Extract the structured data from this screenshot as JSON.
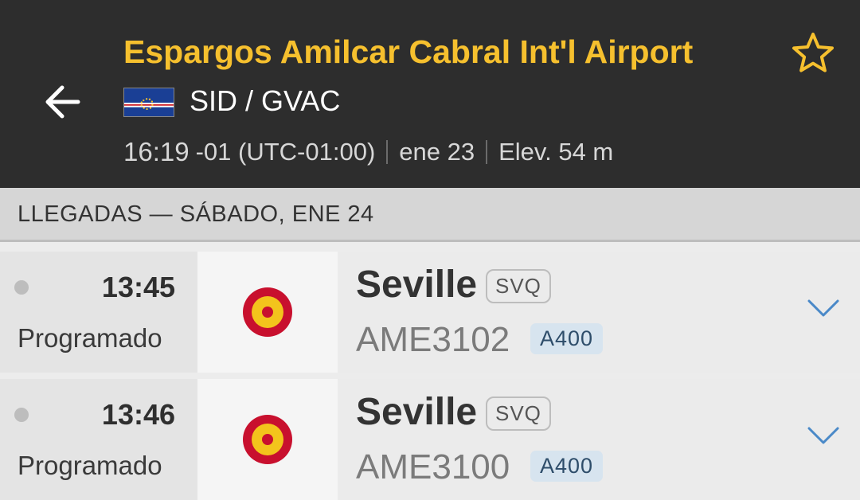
{
  "header": {
    "airport_name": "Espargos Amilcar Cabral Int'l Airport",
    "codes": "SID / GVAC",
    "local_time": "16:19",
    "timezone": "-01 (UTC-01:00)",
    "date": "ene 23",
    "elevation": "Elev. 54 m",
    "accent_color": "#f6c02e",
    "flag": "Cape Verde flag"
  },
  "section": {
    "title": "LLEGADAS — SÁBADO, ENE 24"
  },
  "flights": [
    {
      "time": "13:45",
      "status": "Programado",
      "city": "Seville",
      "iata": "SVQ",
      "flight_number": "AME3102",
      "aircraft": "A400",
      "airline_logo": "spanish-air-force-roundel-icon"
    },
    {
      "time": "13:46",
      "status": "Programado",
      "city": "Seville",
      "iata": "SVQ",
      "flight_number": "AME3100",
      "aircraft": "A400",
      "airline_logo": "spanish-air-force-roundel-icon"
    }
  ]
}
